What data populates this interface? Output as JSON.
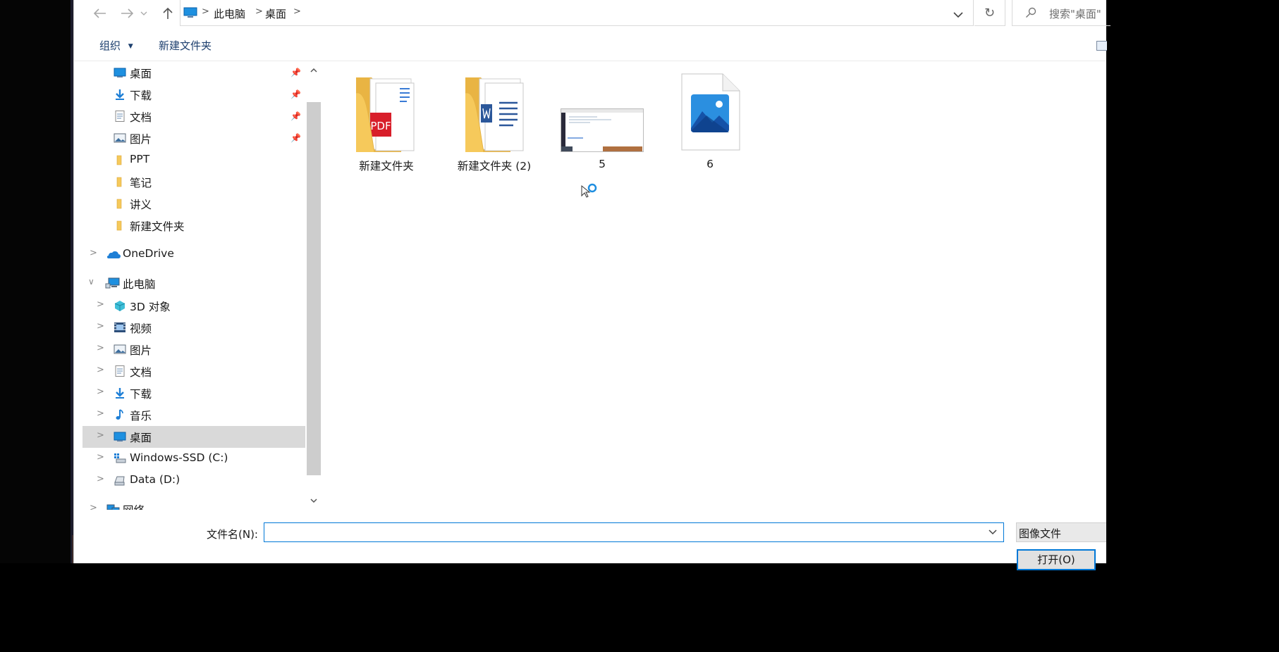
{
  "address": {
    "crumbs": [
      "此电脑",
      "桌面"
    ],
    "search_placeholder": "搜索\"桌面\""
  },
  "toolbar": {
    "organize_label": "组织",
    "new_folder_label": "新建文件夹"
  },
  "nav": {
    "quick_access": [
      {
        "label": "桌面",
        "icon": "desktop-icon",
        "pinned": true
      },
      {
        "label": "下载",
        "icon": "download-arrow-icon",
        "pinned": true
      },
      {
        "label": "文档",
        "icon": "document-icon",
        "pinned": true
      },
      {
        "label": "图片",
        "icon": "pictures-icon",
        "pinned": true
      },
      {
        "label": "PPT",
        "icon": "folder-icon",
        "pinned": false
      },
      {
        "label": "笔记",
        "icon": "folder-icon",
        "pinned": false
      },
      {
        "label": "讲义",
        "icon": "folder-icon",
        "pinned": false
      },
      {
        "label": "新建文件夹",
        "icon": "folder-icon",
        "pinned": false
      }
    ],
    "onedrive_label": "OneDrive",
    "this_pc_label": "此电脑",
    "this_pc_children": [
      {
        "label": "3D 对象",
        "icon": "3d-objects-icon"
      },
      {
        "label": "视频",
        "icon": "video-icon"
      },
      {
        "label": "图片",
        "icon": "pictures-icon"
      },
      {
        "label": "文档",
        "icon": "document-icon"
      },
      {
        "label": "下载",
        "icon": "download-arrow-icon"
      },
      {
        "label": "音乐",
        "icon": "music-note-icon"
      },
      {
        "label": "桌面",
        "icon": "desktop-icon",
        "selected": true
      },
      {
        "label": "Windows-SSD (C:)",
        "icon": "windows-drive-icon"
      },
      {
        "label": "Data (D:)",
        "icon": "drive-icon"
      }
    ],
    "network_label": "网络"
  },
  "files": [
    {
      "name": "新建文件夹",
      "kind": "folder-pdf"
    },
    {
      "name": "新建文件夹 (2)",
      "kind": "folder-word"
    },
    {
      "name": "5",
      "kind": "screenshot-thumbnail"
    },
    {
      "name": "6",
      "kind": "image-file"
    }
  ],
  "file_icon_text": {
    "pdf": "PDF"
  },
  "bottom": {
    "filename_label": "文件名(N):",
    "filename_value": "",
    "filter_label": "图像文件",
    "open_label": "打开(O)"
  },
  "colors": {
    "accent": "#0078d7",
    "folder": "#f6c95b",
    "selected_row": "#d9d9d9"
  }
}
